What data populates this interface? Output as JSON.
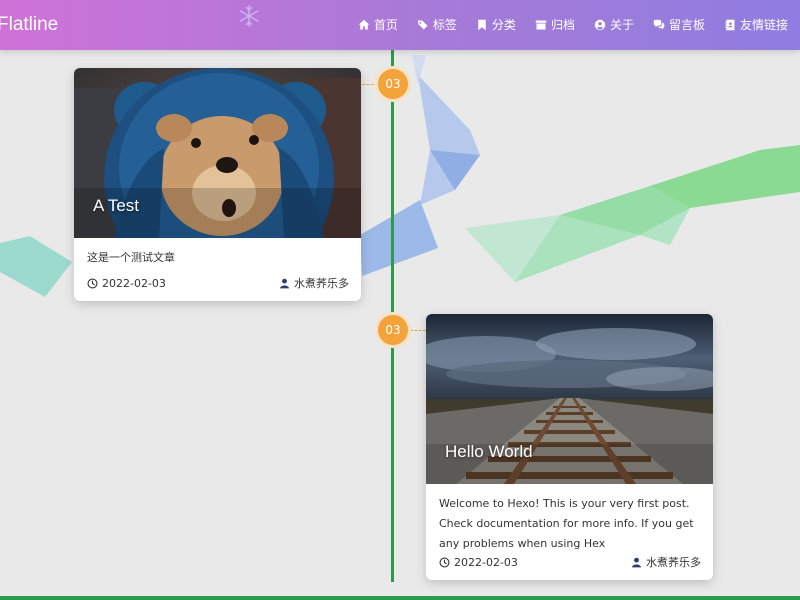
{
  "brand": "Flatline",
  "nav": {
    "items": [
      {
        "label": "首页",
        "icon": "home-icon"
      },
      {
        "label": "标签",
        "icon": "tags-icon"
      },
      {
        "label": "分类",
        "icon": "bookmark-icon"
      },
      {
        "label": "归档",
        "icon": "archive-icon"
      },
      {
        "label": "关于",
        "icon": "user-circle-icon"
      },
      {
        "label": "留言板",
        "icon": "comments-icon"
      },
      {
        "label": "友情链接",
        "icon": "address-book-icon"
      }
    ]
  },
  "timeline": {
    "line_color": "#2e9a4c",
    "badge_color": "#f2a33a",
    "posts": [
      {
        "badge": "03",
        "title": "A Test",
        "excerpt": "这是一个测试文章",
        "date": "2022-02-03",
        "author": "水煮荞乐多",
        "image": "teddy-bear-photo"
      },
      {
        "badge": "03",
        "title": "Hello World",
        "excerpt": "Welcome to Hexo! This is your very first post. Check documentation for more info. If you get any problems when using Hex",
        "date": "2022-02-03",
        "author": "水煮荞乐多",
        "image": "railway-tracks-photo"
      }
    ]
  },
  "colors": {
    "navbar_start": "#cf72d8",
    "navbar_end": "#8f7de0",
    "page_background": "#e9e9e9"
  }
}
